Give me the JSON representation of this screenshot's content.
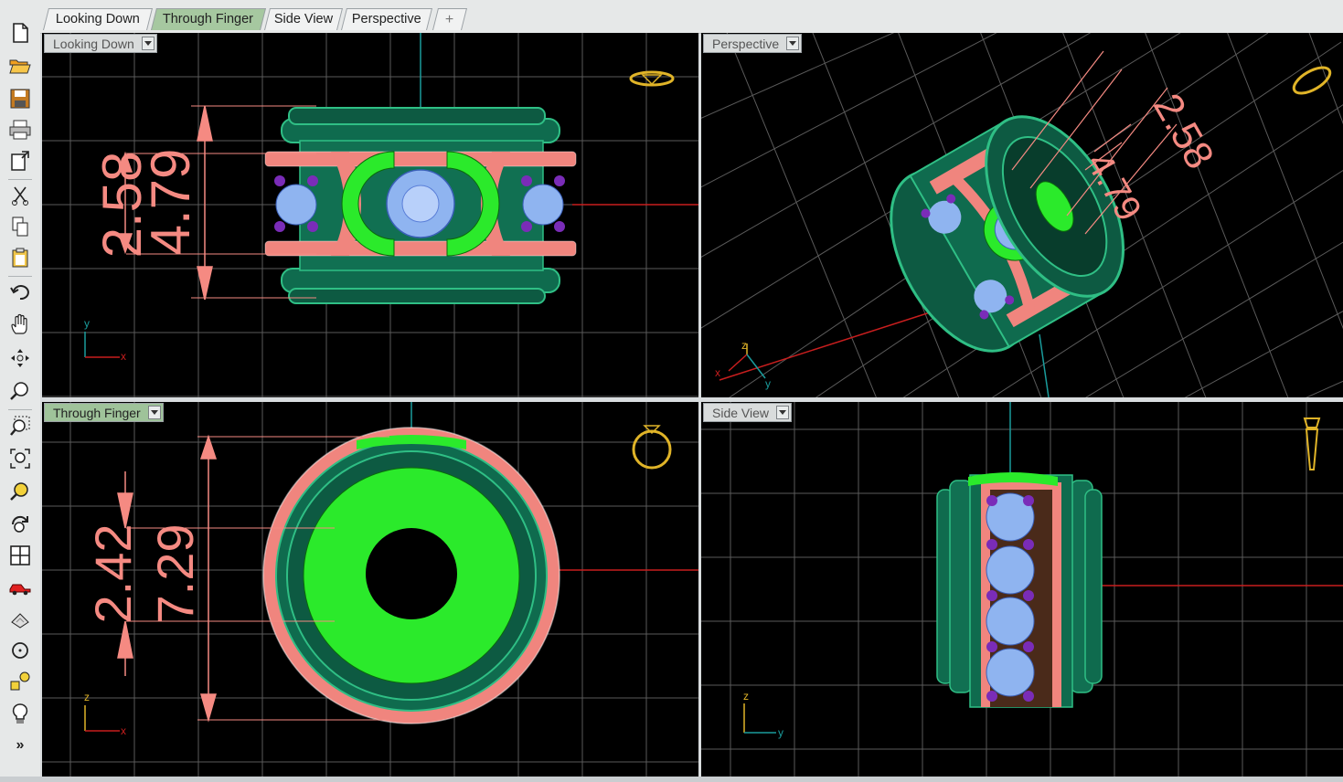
{
  "tabs": [
    {
      "label": "Looking Down",
      "active": false
    },
    {
      "label": "Through Finger",
      "active": true
    },
    {
      "label": "Side View",
      "active": false
    },
    {
      "label": "Perspective",
      "active": false
    }
  ],
  "add_tab_icon": "plus-icon",
  "toolbar": {
    "icons": [
      "new-file-icon",
      "open-folder-icon",
      "save-icon",
      "print-icon",
      "import-icon",
      "cut-icon",
      "copy-icon",
      "paste-icon",
      "undo-icon",
      "pan-hand-icon",
      "rotate-view-icon",
      "zoom-icon",
      "zoom-window-icon",
      "zoom-extents-icon",
      "zoom-selected-icon",
      "rotate-view-3d-icon",
      "four-viewports-icon",
      "car-icon",
      "plane-icon",
      "circle-icon",
      "shapes-icon",
      "lightbulb-icon"
    ],
    "more_label": "»"
  },
  "viewports": {
    "top_left": {
      "label": "Looking Down",
      "dims": [
        "2.58",
        "4.79"
      ],
      "axes": [
        "y",
        "x"
      ]
    },
    "top_right": {
      "label": "Perspective",
      "dims": [
        "2.58",
        "4.79"
      ],
      "axes": [
        "z",
        "x",
        "y"
      ]
    },
    "bottom_left": {
      "label": "Through Finger",
      "dims": [
        "2.42",
        "7.29"
      ],
      "axes": [
        "z",
        "x"
      ]
    },
    "bottom_right": {
      "label": "Side View",
      "axes": [
        "z",
        "y"
      ]
    }
  },
  "colors": {
    "viewport_bg": "#000000",
    "grid": "#5a5a5a",
    "band_green": "#0f6b4e",
    "band_highlight": "#2fbf85",
    "bright_green": "#2bea2b",
    "salmon": "#f0857e",
    "gem_blue": "#8fb4f0",
    "purple": "#7a2cb8",
    "dimension": "#f58a82",
    "x_axis": "#c81e1e",
    "y_axis": "#1a9c9c",
    "gold": "#e0b428",
    "active_tab": "#a6c8a0"
  }
}
